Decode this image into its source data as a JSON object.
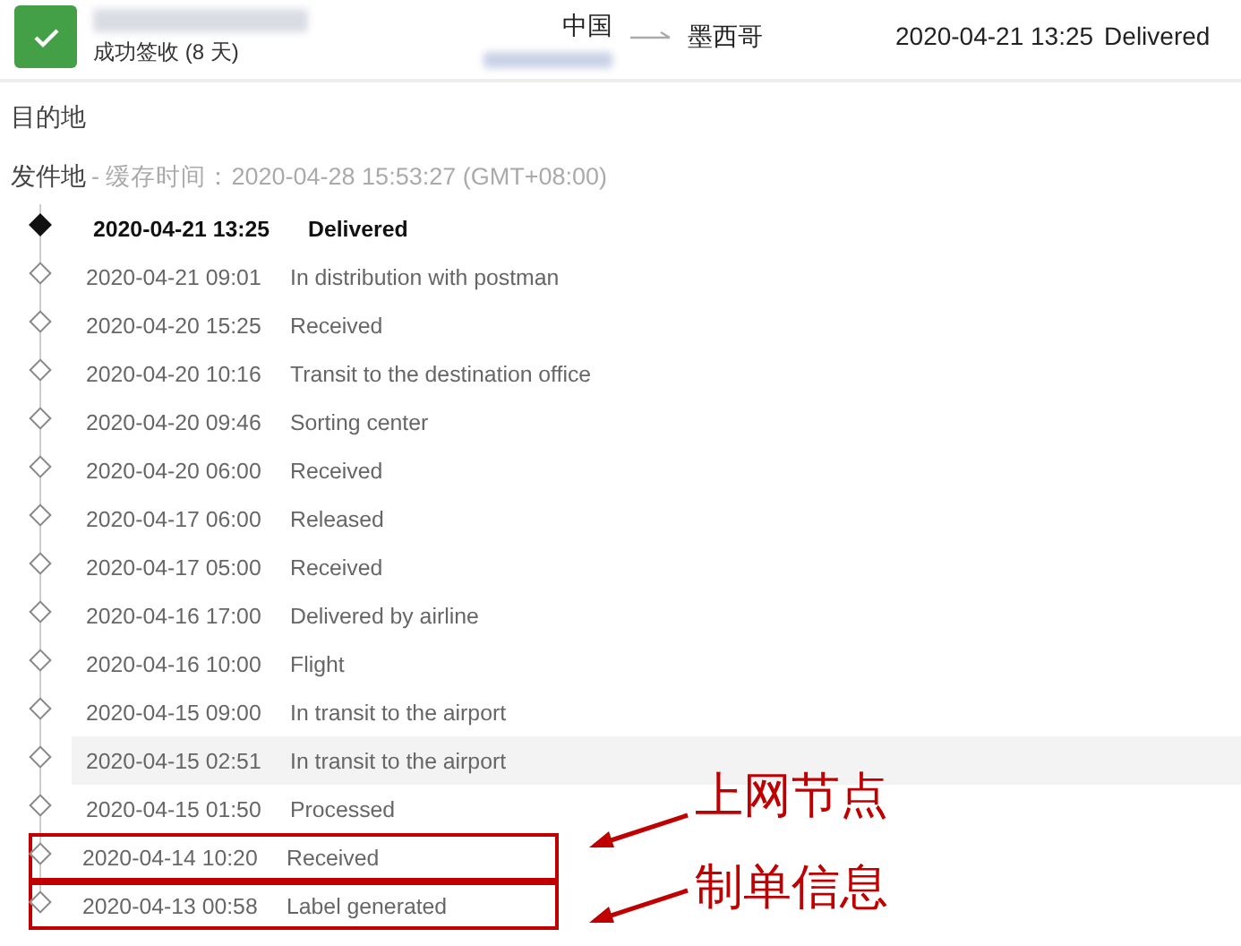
{
  "shipment": {
    "status_delivered": true,
    "status_text": "成功签收 (8 天)",
    "origin": "中国",
    "destination": "墨西哥",
    "latest_time": "2020-04-21 13:25",
    "latest_status": "Delivered"
  },
  "destination_label": "目的地",
  "origin_section": {
    "label": "发件地",
    "cache_note": "- 缓存时间：2020-04-28 15:53:27 (GMT+08:00)"
  },
  "events": [
    {
      "time": "2020-04-21 13:25",
      "description": "Delivered",
      "latest": true,
      "selected": false
    },
    {
      "time": "2020-04-21 09:01",
      "description": "In distribution with postman",
      "latest": false,
      "selected": false
    },
    {
      "time": "2020-04-20 15:25",
      "description": "Received",
      "latest": false,
      "selected": false
    },
    {
      "time": "2020-04-20 10:16",
      "description": "Transit to the destination office",
      "latest": false,
      "selected": false
    },
    {
      "time": "2020-04-20 09:46",
      "description": "Sorting center",
      "latest": false,
      "selected": false
    },
    {
      "time": "2020-04-20 06:00",
      "description": "Received",
      "latest": false,
      "selected": false
    },
    {
      "time": "2020-04-17 06:00",
      "description": "Released",
      "latest": false,
      "selected": false
    },
    {
      "time": "2020-04-17 05:00",
      "description": "Received",
      "latest": false,
      "selected": false
    },
    {
      "time": "2020-04-16 17:00",
      "description": "Delivered by airline",
      "latest": false,
      "selected": false
    },
    {
      "time": "2020-04-16 10:00",
      "description": "Flight",
      "latest": false,
      "selected": false
    },
    {
      "time": "2020-04-15 09:00",
      "description": "In transit to the airport",
      "latest": false,
      "selected": false
    },
    {
      "time": "2020-04-15 02:51",
      "description": "In transit to the airport",
      "latest": false,
      "selected": true
    },
    {
      "time": "2020-04-15 01:50",
      "description": "Processed",
      "latest": false,
      "selected": false
    },
    {
      "time": "2020-04-14 10:20",
      "description": "Received",
      "latest": false,
      "selected": false,
      "annotation": "上网节点"
    },
    {
      "time": "2020-04-13 00:58",
      "description": "Label generated",
      "latest": false,
      "selected": false,
      "annotation": "制单信息"
    }
  ]
}
